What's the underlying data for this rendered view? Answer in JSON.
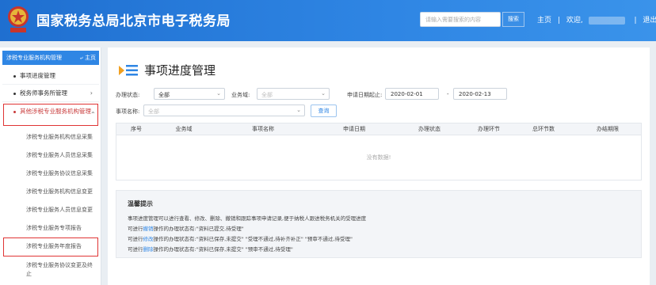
{
  "header": {
    "title": "国家税务总局北京市电子税务局",
    "search_placeholder": "请输入需要搜索的内容",
    "search_button": "搜索",
    "home_link": "主页",
    "separator": "|",
    "welcome": "欢迎,",
    "logout": "退出",
    "bg_color": "#2f86e4"
  },
  "sidebar": {
    "header_label": "涉税专业服务机构管理",
    "home_label": "主页",
    "items": [
      {
        "label": "事项进度管理"
      },
      {
        "label": "税务师事务所管理"
      },
      {
        "label": "其他涉税专业服务机构管理"
      }
    ],
    "subitems": [
      {
        "label": "涉税专业服务机构信息采集"
      },
      {
        "label": "涉税专业服务人员信息采集"
      },
      {
        "label": "涉税专业服务协议信息采集"
      },
      {
        "label": "涉税专业服务机构信息变更"
      },
      {
        "label": "涉税专业服务人员信息变更"
      },
      {
        "label": "涉税专业服务专项报告"
      },
      {
        "label": "涉税专业服务年度报告"
      },
      {
        "label": "涉税专业服务协议变更及终止"
      }
    ],
    "highlight_color": "#e03434"
  },
  "main": {
    "title": "事项进度管理",
    "filters": {
      "status_label": "办理状态:",
      "status_value": "全部",
      "domain_label": "业务域:",
      "domain_placeholder": "全部",
      "date_label": "申请日期起止:",
      "date_from": "2020-02-01",
      "date_sep": "-",
      "date_to": "2020-02-13",
      "item_label": "事项名称:",
      "item_placeholder": "全部",
      "query_button": "查询"
    },
    "table": {
      "columns": [
        "序号",
        "业务域",
        "事项名称",
        "申请日期",
        "办理状态",
        "办理环节",
        "总环节数",
        "办结期限"
      ],
      "empty_text": "没有数据!"
    },
    "tips": {
      "title": "温馨提示",
      "line1": "事项进度管理可以进行查看、修改、删除、撤销和跟踪事项申请记录,便于纳税人跟进税务机关的受理进度",
      "line2_pre": "可进行",
      "line2_act": "撤销",
      "line2_post": "操作的办理状态有:\"资料已提交,待受理\"",
      "line3_pre": "可进行",
      "line3_act": "修改",
      "line3_post": "操作的办理状态有:\"资料已保存,未提交\"  \"受理不通过,待补齐补正\"  \"预审不通过,待受理\"",
      "line4_pre": "可进行",
      "line4_act": "删除",
      "line4_post": "操作的办理状态有:\"资料已保存,未提交\"  \"预审不通过,待受理\""
    },
    "accent_color": "#2f86e4"
  }
}
